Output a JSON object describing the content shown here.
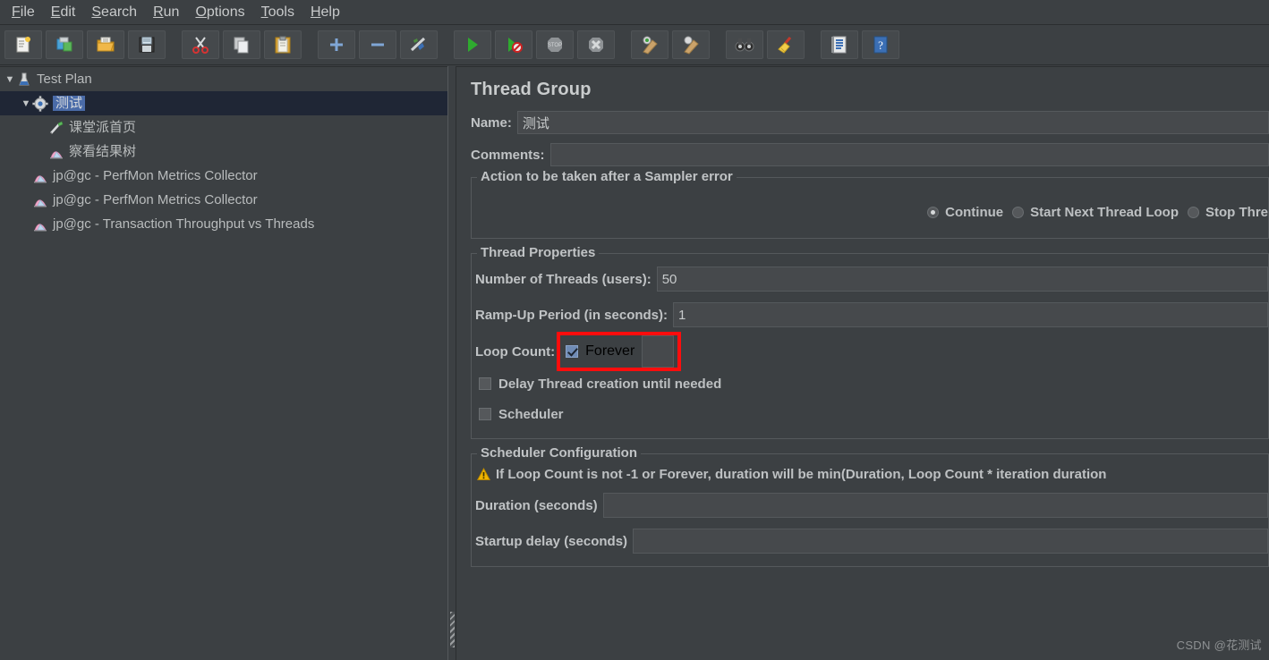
{
  "menubar": {
    "items": [
      {
        "label": "File",
        "mnemonic": "F"
      },
      {
        "label": "Edit",
        "mnemonic": "E"
      },
      {
        "label": "Search",
        "mnemonic": "S"
      },
      {
        "label": "Run",
        "mnemonic": "R"
      },
      {
        "label": "Options",
        "mnemonic": "O"
      },
      {
        "label": "Tools",
        "mnemonic": "T"
      },
      {
        "label": "Help",
        "mnemonic": "H"
      }
    ]
  },
  "toolbar": {
    "buttons": [
      {
        "name": "new-icon",
        "title": "New"
      },
      {
        "name": "templates-icon",
        "title": "Templates"
      },
      {
        "name": "open-icon",
        "title": "Open"
      },
      {
        "name": "save-icon",
        "title": "Save"
      },
      {
        "name": "cut-icon",
        "title": "Cut"
      },
      {
        "name": "copy-icon",
        "title": "Copy"
      },
      {
        "name": "paste-icon",
        "title": "Paste"
      },
      {
        "name": "expand-all-icon",
        "title": "Expand All"
      },
      {
        "name": "collapse-all-icon",
        "title": "Collapse All"
      },
      {
        "name": "toggle-icon",
        "title": "Toggle"
      },
      {
        "name": "start-icon",
        "title": "Start"
      },
      {
        "name": "start-no-pauses-icon",
        "title": "Start no pauses"
      },
      {
        "name": "stop-icon",
        "title": "Stop"
      },
      {
        "name": "shutdown-icon",
        "title": "Shutdown"
      },
      {
        "name": "clear-icon",
        "title": "Clear"
      },
      {
        "name": "clear-all-icon",
        "title": "Clear All"
      },
      {
        "name": "search-icon",
        "title": "Search"
      },
      {
        "name": "reset-search-icon",
        "title": "Reset Search"
      },
      {
        "name": "function-helper-icon",
        "title": "Function Helper Dialog"
      },
      {
        "name": "help-icon",
        "title": "Help"
      }
    ]
  },
  "tree": {
    "nodes": [
      {
        "label": "Test Plan",
        "icon": "test-plan-icon",
        "twisty": "▼",
        "depth": 0,
        "selected": false,
        "highlighted": false
      },
      {
        "label": "测试",
        "icon": "thread-group-icon",
        "twisty": "▼",
        "depth": 1,
        "selected": true,
        "highlighted": true
      },
      {
        "label": "课堂派首页",
        "icon": "http-sampler-icon",
        "twisty": "",
        "depth": 2,
        "selected": false,
        "highlighted": false
      },
      {
        "label": "察看结果树",
        "icon": "listener-icon",
        "twisty": "",
        "depth": 2,
        "selected": false,
        "highlighted": false
      },
      {
        "label": "jp@gc - PerfMon Metrics Collector",
        "icon": "listener-icon",
        "twisty": "",
        "depth": 2,
        "selected": false,
        "highlighted": false
      },
      {
        "label": "jp@gc - PerfMon Metrics Collector",
        "icon": "listener-icon",
        "twisty": "",
        "depth": 2,
        "selected": false,
        "highlighted": false
      },
      {
        "label": "jp@gc - Transaction Throughput vs Threads",
        "icon": "listener-icon",
        "twisty": "",
        "depth": 2,
        "selected": false,
        "highlighted": false
      }
    ]
  },
  "panel": {
    "title": "Thread Group",
    "name_label": "Name:",
    "name_value": "测试",
    "comments_label": "Comments:",
    "comments_value": "",
    "sampler_error": {
      "legend": "Action to be taken after a Sampler error",
      "options": [
        {
          "label": "Continue",
          "selected": true
        },
        {
          "label": "Start Next Thread Loop",
          "selected": false
        },
        {
          "label": "Stop Thre",
          "selected": false
        }
      ]
    },
    "thread_properties": {
      "legend": "Thread Properties",
      "threads_label": "Number of Threads (users):",
      "threads_value": "50",
      "rampup_label": "Ramp-Up Period (in seconds):",
      "rampup_value": "1",
      "loop_count_label": "Loop Count:",
      "forever_label": "Forever",
      "forever_checked": true,
      "loop_count_value": "",
      "delay_label": "Delay Thread creation until needed",
      "delay_checked": false,
      "scheduler_label": "Scheduler",
      "scheduler_checked": false
    },
    "scheduler_configuration": {
      "legend": "Scheduler Configuration",
      "warning": "If Loop Count is not -1 or Forever, duration will be min(Duration, Loop Count * iteration duration",
      "duration_label": "Duration (seconds)",
      "duration_value": "",
      "startup_label": "Startup delay (seconds)",
      "startup_value": ""
    }
  },
  "watermark": "CSDN @花测试",
  "colors": {
    "background": "#3c4043",
    "field": "#46494c",
    "text": "#c0c3c5",
    "selection": "#4a6ba8",
    "selected_row": "#1f2635",
    "highlight_box": "#fd0d0d",
    "warning": "#f0b400"
  }
}
